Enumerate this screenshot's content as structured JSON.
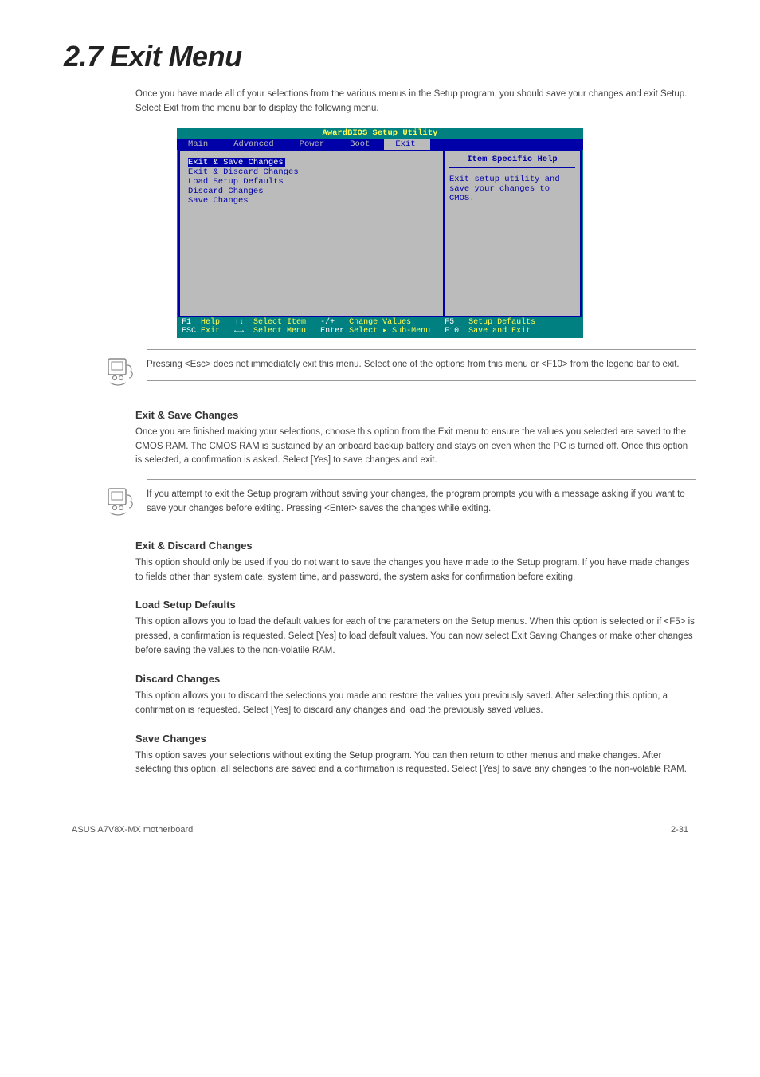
{
  "heading": "2.7    Exit Menu",
  "intro": "Once you have made all of your selections from the various menus in the Setup program, you should save your changes and exit Setup. Select Exit from the menu bar to display the following menu.",
  "bios": {
    "title": "AwardBIOS Setup Utility",
    "menu": {
      "items": [
        "Main",
        "Advanced",
        "Power",
        "Boot",
        "Exit"
      ],
      "active": "Exit"
    },
    "left_items": [
      "Exit & Save Changes",
      "Exit & Discard Changes",
      "Load Setup Defaults",
      "Discard Changes",
      "Save Changes"
    ],
    "left_highlight_index": 0,
    "help_header": "Item Specific Help",
    "help_body": "Exit setup utility and save your changes to CMOS.",
    "footer_line1_keys": "F1",
    "footer_line1_a": "  Help   ",
    "footer_line1_k2": "↑↓",
    "footer_line1_b": "  Select Item   ",
    "footer_line1_k3": "-/+",
    "footer_line1_c": "   Change Values       ",
    "footer_line1_k4": "F5",
    "footer_line1_d": "   Setup Defaults",
    "footer_line2_keys": "ESC",
    "footer_line2_a": " Exit   ",
    "footer_line2_k2": "←→",
    "footer_line2_b": "  Select Menu   ",
    "footer_line2_k3": "Enter",
    "footer_line2_c": " Select ▸ Sub-Menu   ",
    "footer_line2_k4": "F10",
    "footer_line2_d": "  Save and Exit"
  },
  "note1": "Pressing <Esc> does not immediately exit this menu. Select one of the options from this menu or <F10> from the legend bar to exit.",
  "sub1_title": "Exit & Save Changes",
  "sub1_body": "Once you are finished making your selections, choose this option from the Exit menu to ensure the values you selected are saved to the CMOS RAM. The CMOS RAM is sustained by an onboard backup battery and stays on even when the PC is turned off. Once this option is selected, a confirmation is asked. Select [Yes] to save changes and exit.",
  "note2": "If you attempt to exit the Setup program without saving your changes, the program prompts you with a message asking if you want to save your changes before exiting. Pressing <Enter> saves the changes while exiting.",
  "sub2_title": "Exit & Discard Changes",
  "sub2_body": "This option should only be used if you do not want to save the changes you have made to the Setup program. If you have made changes to fields other than system date, system time, and password, the system asks for confirmation before exiting.",
  "sub3_title": "Load Setup Defaults",
  "sub3_body": "This option allows you to load the default values for each of the parameters on the Setup menus. When this option is selected or if <F5> is pressed, a confirmation is requested. Select [Yes] to load default values. You can now select Exit Saving Changes or make other changes before saving the values to the non-volatile RAM.",
  "sub4_title": "Discard Changes",
  "sub4_body": "This option allows you to discard the selections you made and restore the values you previously saved. After selecting this option, a confirmation is requested. Select [Yes] to discard any changes and load the previously saved values.",
  "sub5_title": "Save Changes",
  "sub5_body": "This option saves your selections without exiting the Setup program. You can then return to other menus and make changes. After selecting this option, all selections are saved and a confirmation is requested. Select [Yes] to save any changes to the non-volatile RAM.",
  "footer_left": "ASUS A7V8X-MX motherboard",
  "footer_right": "2-31"
}
